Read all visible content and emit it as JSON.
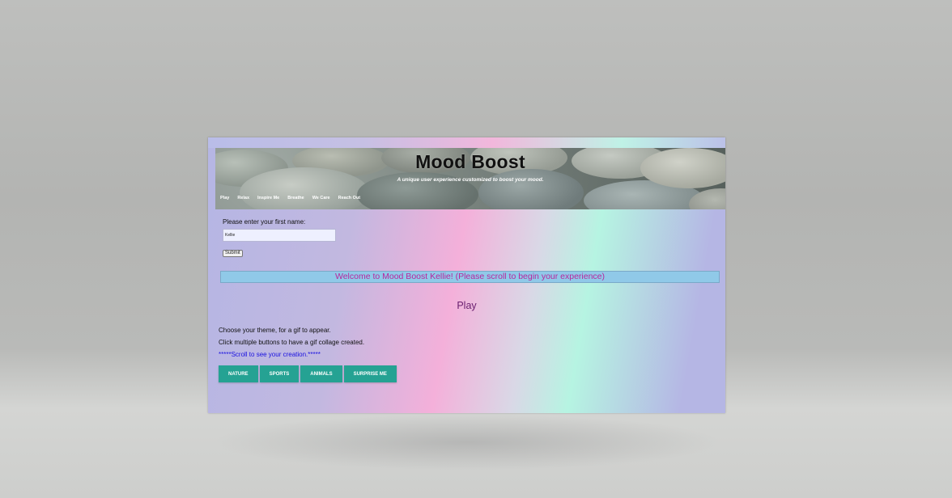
{
  "header": {
    "title": "Mood Boost",
    "subtitle": "A unique user experience customized to boost your mood."
  },
  "nav": {
    "items": [
      "Play",
      "Relax",
      "Inspire Me",
      "Breathe",
      "We Care",
      "Reach Out"
    ]
  },
  "form": {
    "label": "Please enter your first name:",
    "name_value": "Kellie",
    "submit_label": "Submit"
  },
  "welcome": {
    "message": "Welcome to Mood Boost Kellie! (Please scroll to begin your experience)"
  },
  "play": {
    "title": "Play",
    "line1": "Choose your theme, for a gif to appear.",
    "line2": "Click multiple buttons to have a gif collage created.",
    "line3": "*****Scroll to see your creation.*****",
    "buttons": [
      "NATURE",
      "SPORTS",
      "ANIMALS",
      "SURPRISE ME"
    ]
  },
  "colors": {
    "accent_button": "#25a293",
    "welcome_bg": "#90c9e8",
    "welcome_text": "#b8279d",
    "play_title": "#6a1f6f",
    "scroll_note": "#1a11e0"
  }
}
